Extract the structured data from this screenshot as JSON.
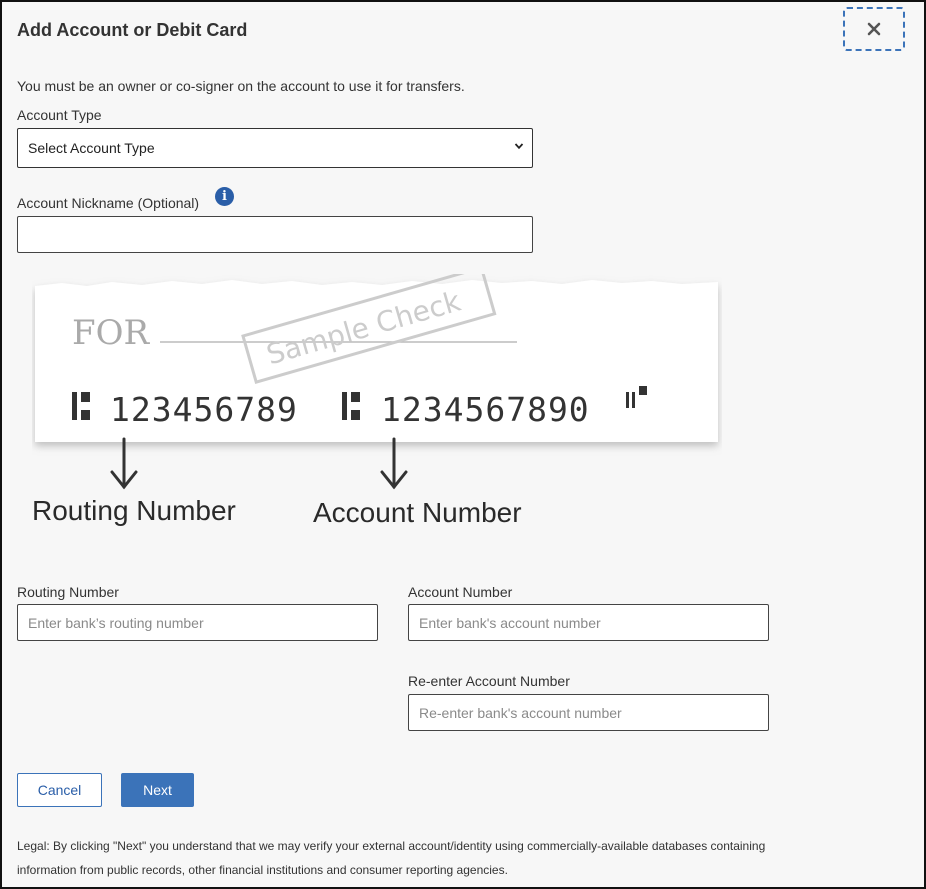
{
  "modal": {
    "title": "Add Account or Debit Card",
    "close_icon": "close-x-icon"
  },
  "notice": "You must be an owner or co-signer on the account to use it for transfers.",
  "account_type": {
    "label": "Account Type",
    "selected": "Select Account Type",
    "icon": "chevron-down-icon"
  },
  "nickname": {
    "label": "Account Nickname (Optional)",
    "value": "",
    "info_icon": "info-icon"
  },
  "check_illustration": {
    "for_label": "FOR",
    "stamp": "Sample Check",
    "routing_digits": "123456789",
    "account_digits": "1234567890",
    "routing_caption": "Routing Number",
    "account_caption": "Account Number"
  },
  "routing": {
    "label": "Routing Number",
    "placeholder": "Enter bank’s routing number"
  },
  "account_number": {
    "label": "Account Number",
    "placeholder": "Enter bank's account number"
  },
  "reenter_account": {
    "label": "Re-enter Account Number",
    "placeholder": "Re-enter bank's account number"
  },
  "buttons": {
    "cancel": "Cancel",
    "next": "Next"
  },
  "legal": "Legal: By clicking \"Next\" you understand that we may verify your external account/identity using commercially-available databases containing information from public records, other financial institutions and consumer reporting agencies.",
  "colors": {
    "primary": "#3b73b9",
    "info": "#2a5ea8",
    "border": "#333333",
    "background": "#f7f7f7"
  }
}
